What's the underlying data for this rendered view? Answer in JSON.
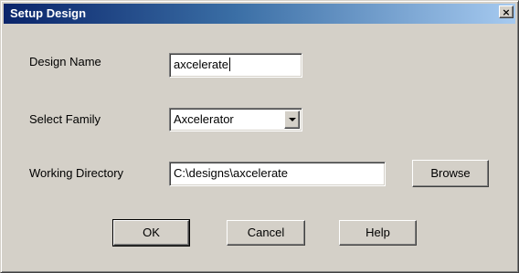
{
  "window": {
    "title": "Setup Design",
    "close_glyph": "×"
  },
  "form": {
    "design_name_label": "Design Name",
    "design_name_value": "axcelerate",
    "family_label": "Select Family",
    "family_value": "Axcelerator",
    "dir_label": "Working Directory",
    "dir_value": "C:\\designs\\axcelerate"
  },
  "buttons": {
    "browse": "Browse",
    "ok": "OK",
    "cancel": "Cancel",
    "help": "Help"
  },
  "icons": {
    "close": "close-icon",
    "dropdown": "chevron-down-icon"
  }
}
